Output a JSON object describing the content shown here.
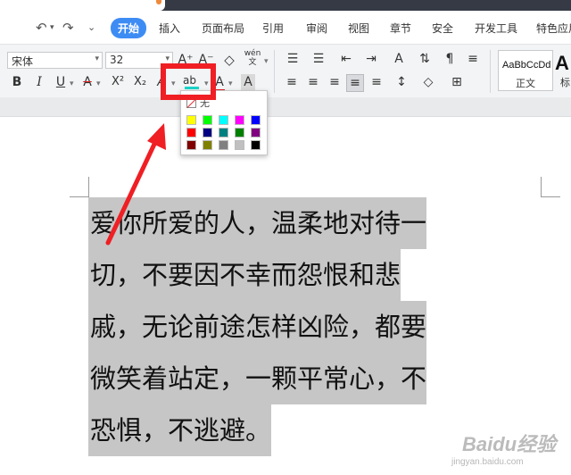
{
  "quick_access": {
    "undo": "↶",
    "redo": "↷",
    "customize": "⌄"
  },
  "menu": {
    "tabs": [
      {
        "label": "开始",
        "active": true
      },
      {
        "label": "插入"
      },
      {
        "label": "页面布局"
      },
      {
        "label": "引用"
      },
      {
        "label": "审阅"
      },
      {
        "label": "视图"
      },
      {
        "label": "章节"
      },
      {
        "label": "安全"
      },
      {
        "label": "开发工具"
      },
      {
        "label": "特色应用"
      }
    ]
  },
  "ribbon": {
    "font_name": "宋体",
    "font_size": "32",
    "grow_font": "A⁺",
    "shrink_font": "A⁻",
    "clear_format": "◇",
    "phonetic": "wén",
    "bold": "B",
    "italic": "I",
    "underline": "U",
    "strikethrough": "A",
    "superscript": "X²",
    "subscript": "X₂",
    "font_effect": "A",
    "highlight": "ab",
    "font_color": "A",
    "char_shading": "A",
    "style_sample": "AaBbCcDd",
    "style_name": "正文",
    "big_a": "A",
    "big_a_label": "标"
  },
  "palette": {
    "none_label": "无",
    "colors": [
      [
        "#ffff00",
        "#00ff00",
        "#00ffff",
        "#ff00ff",
        "#0000ff"
      ],
      [
        "#ff0000",
        "#000080",
        "#008080",
        "#008000",
        "#800080"
      ],
      [
        "#800000",
        "#808000",
        "#808080",
        "#c0c0c0",
        "#000000"
      ]
    ]
  },
  "document": {
    "lines": [
      "爱你所爱的人，温柔地对待一",
      "切，不要因不幸而怨恨和悲",
      "戚，无论前途怎样凶险，都要",
      "微笑着站定，一颗平常心，不",
      "恐惧，不逃避。"
    ]
  },
  "watermark": {
    "logo": "Baidu经验",
    "url": "jingyan.baidu.com"
  },
  "accent_colors": {
    "tab_active": "#3d8cf4",
    "annotation_red": "#ef1f24",
    "selection_gray": "#c6c6c6"
  }
}
